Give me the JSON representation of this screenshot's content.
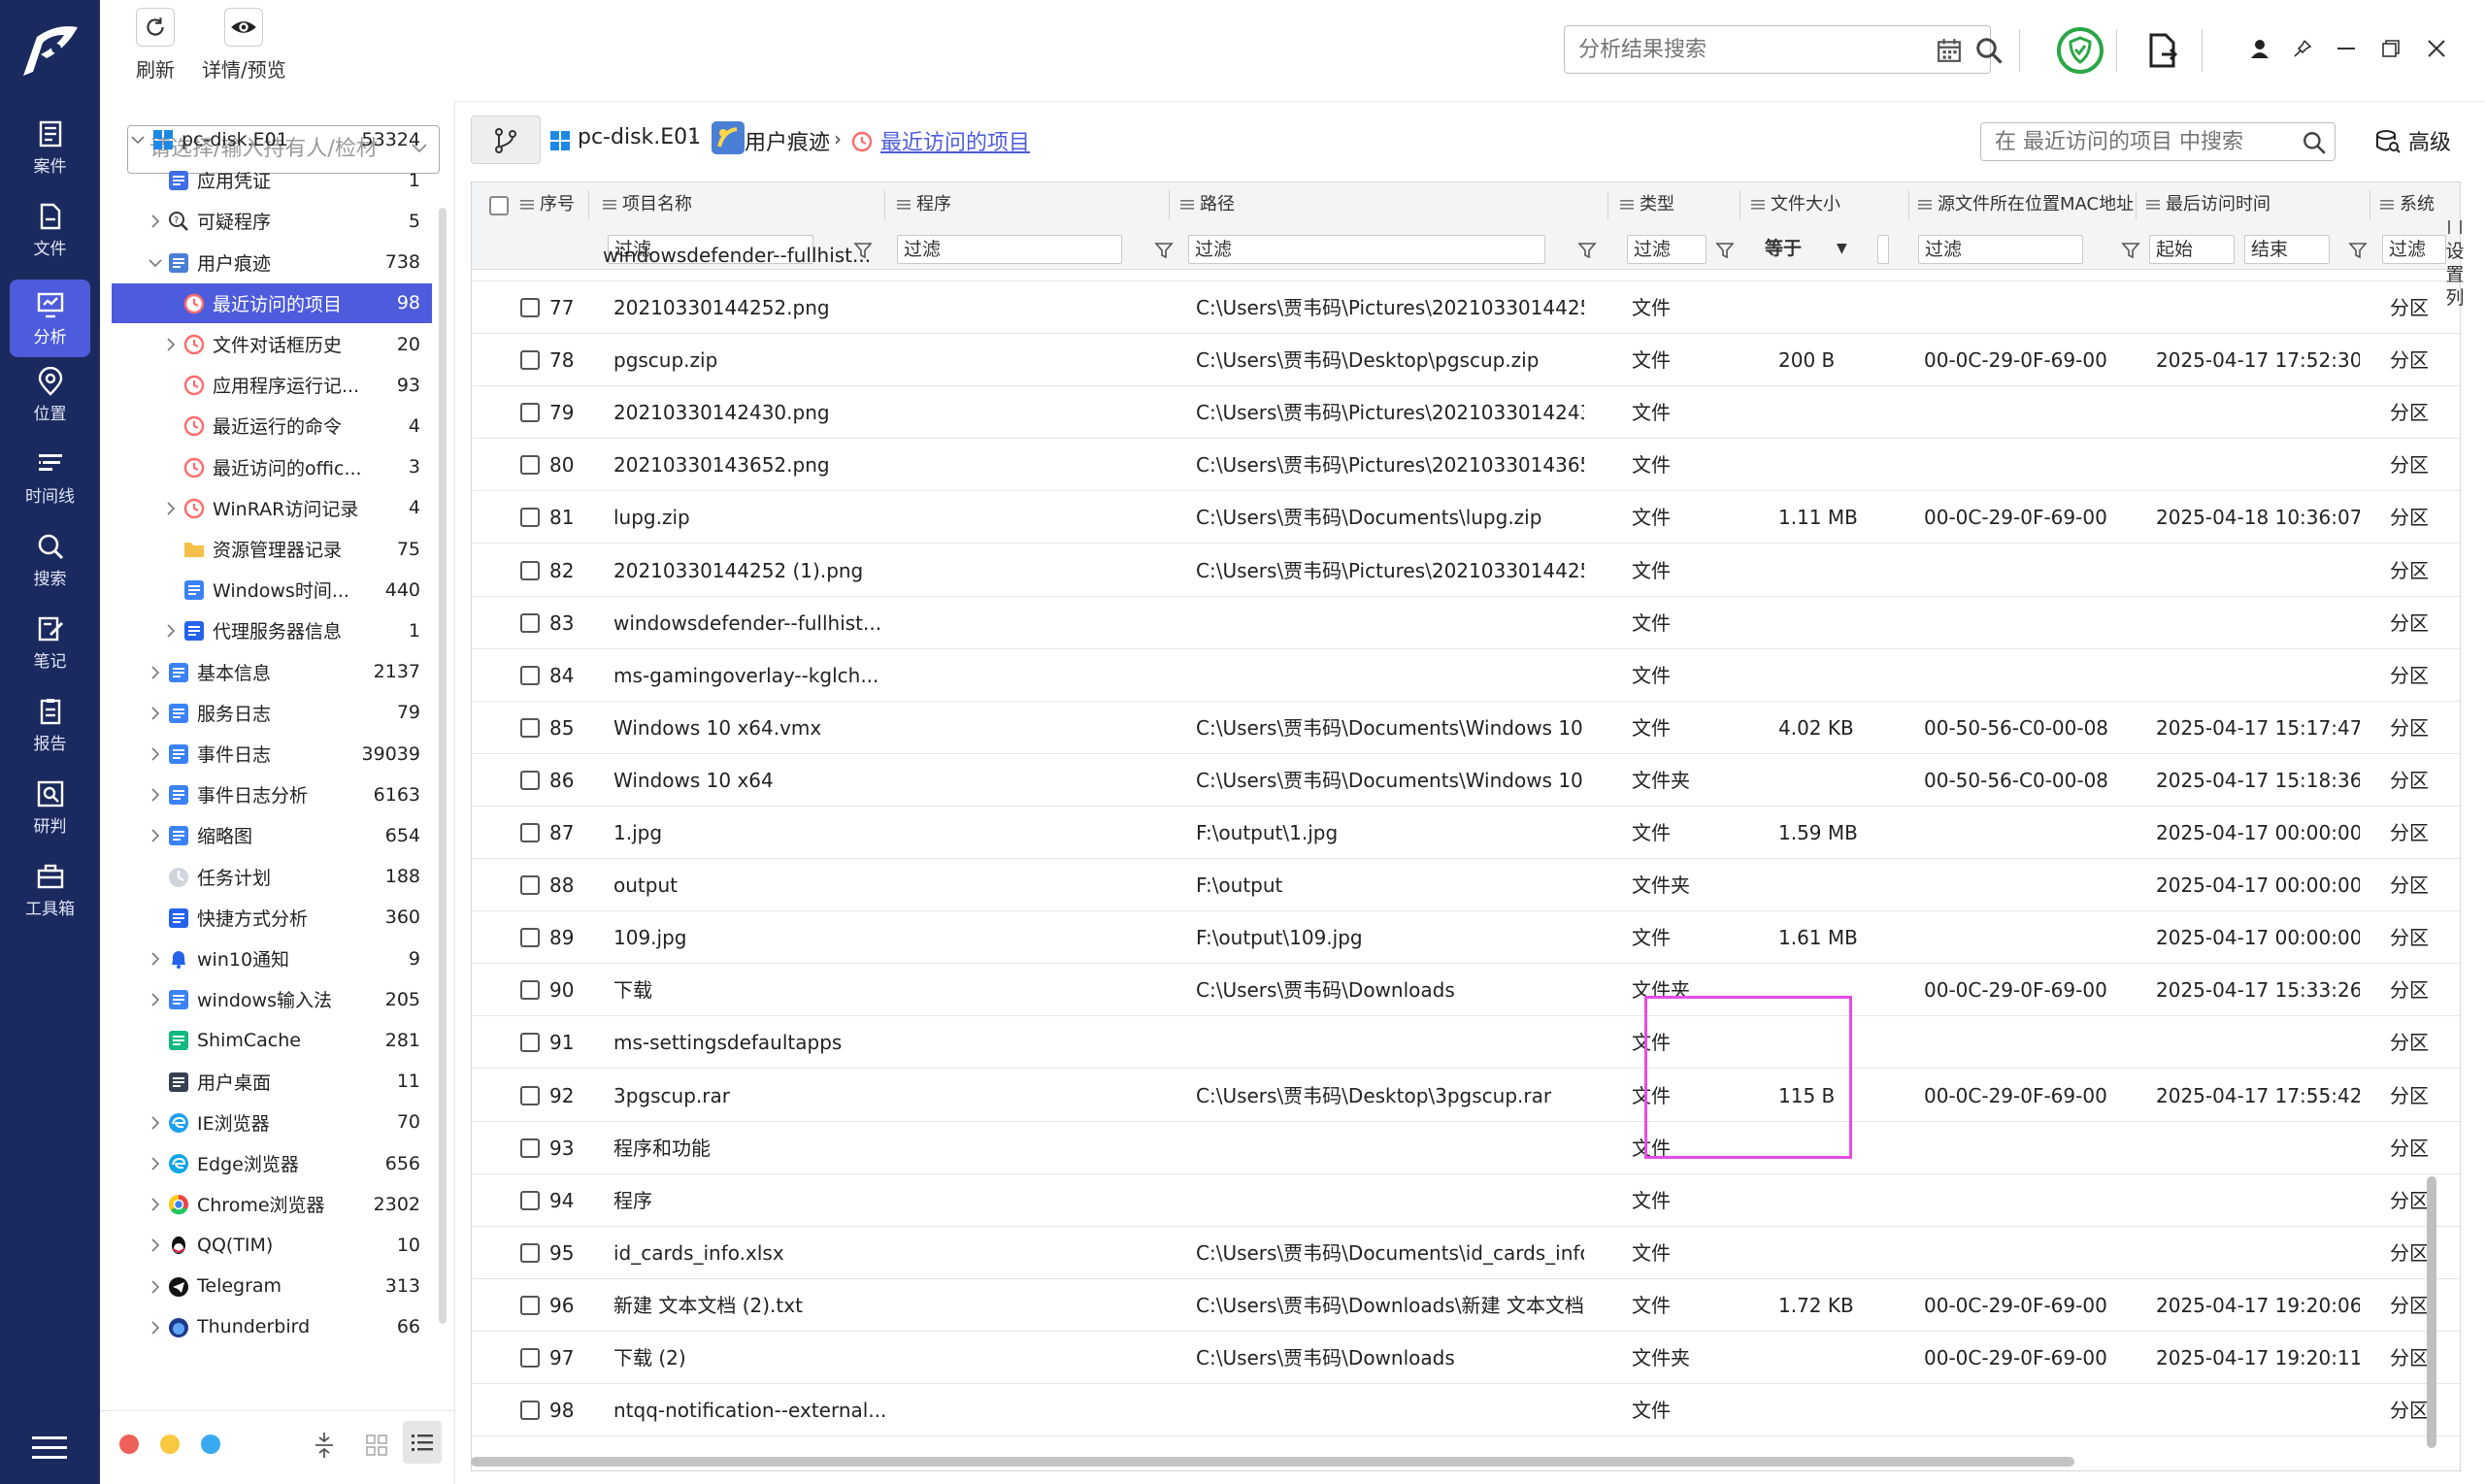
{
  "toolbar": {
    "refresh_label": "刷新",
    "detail_label": "详情/预览",
    "search_placeholder": "分析结果搜索"
  },
  "nav": [
    {
      "label": "案件",
      "icon": "case-icon"
    },
    {
      "label": "文件",
      "icon": "file-icon"
    },
    {
      "label": "分析",
      "icon": "analysis-icon",
      "active": true
    },
    {
      "label": "位置",
      "icon": "location-icon"
    },
    {
      "label": "时间线",
      "icon": "timeline-icon"
    },
    {
      "label": "搜索",
      "icon": "search-icon"
    },
    {
      "label": "笔记",
      "icon": "note-icon"
    },
    {
      "label": "报告",
      "icon": "report-icon"
    },
    {
      "label": "研判",
      "icon": "judge-icon"
    },
    {
      "label": "工具箱",
      "icon": "toolbox-icon"
    }
  ],
  "sidebar": {
    "owner_placeholder": "请选择/输入持有人/检材",
    "tree": [
      {
        "label": "pc-disk.E01",
        "count": "53324",
        "level": 0,
        "expanded": true,
        "icon": "windows-icon",
        "color": "#1e88e5"
      },
      {
        "label": "应用凭证",
        "count": "1",
        "level": 1,
        "icon": "credential-icon",
        "color": "#3f6ee8"
      },
      {
        "label": "可疑程序",
        "count": "5",
        "level": 1,
        "chev": true,
        "icon": "suspicious-icon",
        "color": "#333333"
      },
      {
        "label": "用户痕迹",
        "count": "738",
        "level": 1,
        "expanded": true,
        "icon": "user-trace-icon",
        "color": "#4a7fd6"
      },
      {
        "label": "最近访问的项目",
        "count": "98",
        "level": 2,
        "selected": true,
        "icon": "clock-icon",
        "color": "#ff6b6b"
      },
      {
        "label": "文件对话框历史",
        "count": "20",
        "level": 2,
        "chev": true,
        "icon": "clock-icon",
        "color": "#ff6b6b"
      },
      {
        "label": "应用程序运行记...",
        "count": "93",
        "level": 2,
        "icon": "clock-icon",
        "color": "#ff6b6b"
      },
      {
        "label": "最近运行的命令",
        "count": "4",
        "level": 2,
        "icon": "clock-icon",
        "color": "#ff6b6b"
      },
      {
        "label": "最近访问的offic...",
        "count": "3",
        "level": 2,
        "icon": "clock-icon",
        "color": "#ff6b6b"
      },
      {
        "label": "WinRAR访问记录",
        "count": "4",
        "level": 2,
        "chev": true,
        "icon": "clock-icon",
        "color": "#ff6b6b"
      },
      {
        "label": "资源管理器记录",
        "count": "75",
        "level": 2,
        "icon": "folder-icon",
        "color": "#f5c04a"
      },
      {
        "label": "Windows时间...",
        "count": "440",
        "level": 2,
        "icon": "timeline-list-icon",
        "color": "#3b82f6"
      },
      {
        "label": "代理服务器信息",
        "count": "1",
        "level": 2,
        "chev": true,
        "icon": "proxy-icon",
        "color": "#2563eb"
      },
      {
        "label": "基本信息",
        "count": "2137",
        "level": 1,
        "chev": true,
        "icon": "info-icon",
        "color": "#3b82f6"
      },
      {
        "label": "服务日志",
        "count": "79",
        "level": 1,
        "chev": true,
        "icon": "service-icon",
        "color": "#3b82f6"
      },
      {
        "label": "事件日志",
        "count": "39039",
        "level": 1,
        "chev": true,
        "icon": "event-log-icon",
        "color": "#3b82f6"
      },
      {
        "label": "事件日志分析",
        "count": "6163",
        "level": 1,
        "chev": true,
        "icon": "event-analysis-icon",
        "color": "#3b82f6"
      },
      {
        "label": "缩略图",
        "count": "654",
        "level": 1,
        "chev": true,
        "icon": "thumbnail-icon",
        "color": "#3b82f6"
      },
      {
        "label": "任务计划",
        "count": "188",
        "level": 1,
        "icon": "task-icon",
        "color": "#9ca3af"
      },
      {
        "label": "快捷方式分析",
        "count": "360",
        "level": 1,
        "icon": "shortcut-icon",
        "color": "#2563eb"
      },
      {
        "label": "win10通知",
        "count": "9",
        "level": 1,
        "chev": true,
        "icon": "bell-icon",
        "color": "#2563eb"
      },
      {
        "label": "windows输入法",
        "count": "205",
        "level": 1,
        "chev": true,
        "icon": "keyboard-icon",
        "color": "#3b82f6"
      },
      {
        "label": "ShimCache",
        "count": "281",
        "level": 1,
        "icon": "shimcache-icon",
        "color": "#10b981"
      },
      {
        "label": "用户桌面",
        "count": "11",
        "level": 1,
        "icon": "desktop-icon",
        "color": "#374151"
      },
      {
        "label": "IE浏览器",
        "count": "70",
        "level": 1,
        "chev": true,
        "icon": "ie-icon",
        "color": "#1da1f2"
      },
      {
        "label": "Edge浏览器",
        "count": "656",
        "level": 1,
        "chev": true,
        "icon": "edge-icon",
        "color": "#0ea5e9"
      },
      {
        "label": "Chrome浏览器",
        "count": "2302",
        "level": 1,
        "chev": true,
        "icon": "chrome-icon",
        "color": "#ef4444"
      },
      {
        "label": "QQ(TIM)",
        "count": "10",
        "level": 1,
        "chev": true,
        "icon": "qq-icon",
        "color": "#111111"
      },
      {
        "label": "Telegram",
        "count": "313",
        "level": 1,
        "chev": true,
        "icon": "telegram-icon",
        "color": "#111111"
      },
      {
        "label": "Thunderbird",
        "count": "66",
        "level": 1,
        "chev": true,
        "icon": "thunderbird-icon",
        "color": "#1e3a8a"
      }
    ]
  },
  "breadcrumb": {
    "disk": "pc-disk.E01",
    "group": "用户痕迹",
    "current": "最近访问的项目",
    "filter_placeholder": "在 最近访问的项目 中搜索",
    "advanced_label": "高级"
  },
  "grid": {
    "columns": [
      "序号",
      "项目名称",
      "程序",
      "路径",
      "类型",
      "文件大小",
      "源文件所在位置MAC地址",
      "最后访问时间",
      "系统"
    ],
    "filters": {
      "placeholder": "过滤",
      "size_op": "等于",
      "start": "起始",
      "end": "结束"
    },
    "column_setting": "设置列",
    "partial_row": {
      "name": "windowsdefender--fullhist..."
    },
    "rows": [
      {
        "id": "77",
        "name": "20210330144252.png",
        "path": "C:\\Users\\贾韦码\\Pictures\\20210330144252...",
        "type": "文件",
        "size": "",
        "mac": "",
        "time": "",
        "sys": "分区"
      },
      {
        "id": "78",
        "name": "pgscup.zip",
        "path": "C:\\Users\\贾韦码\\Desktop\\pgscup.zip",
        "type": "文件",
        "size": "200 B",
        "mac": "00-0C-29-0F-69-00",
        "time": "2025-04-17 17:52:30",
        "sys": "分区"
      },
      {
        "id": "79",
        "name": "20210330142430.png",
        "path": "C:\\Users\\贾韦码\\Pictures\\20210330142430...",
        "type": "文件",
        "size": "",
        "mac": "",
        "time": "",
        "sys": "分区"
      },
      {
        "id": "80",
        "name": "20210330143652.png",
        "path": "C:\\Users\\贾韦码\\Pictures\\20210330143652...",
        "type": "文件",
        "size": "",
        "mac": "",
        "time": "",
        "sys": "分区"
      },
      {
        "id": "81",
        "name": "lupg.zip",
        "path": "C:\\Users\\贾韦码\\Documents\\lupg.zip",
        "type": "文件",
        "size": "1.11 MB",
        "mac": "00-0C-29-0F-69-00",
        "time": "2025-04-18 10:36:07",
        "sys": "分区"
      },
      {
        "id": "82",
        "name": "20210330144252 (1).png",
        "path": "C:\\Users\\贾韦码\\Pictures\\20210330144252...",
        "type": "文件",
        "size": "",
        "mac": "",
        "time": "",
        "sys": "分区"
      },
      {
        "id": "83",
        "name": "windowsdefender--fullhist...",
        "path": "",
        "type": "文件",
        "size": "",
        "mac": "",
        "time": "",
        "sys": "分区"
      },
      {
        "id": "84",
        "name": "ms-gamingoverlay--kglch...",
        "path": "",
        "type": "文件",
        "size": "",
        "mac": "",
        "time": "",
        "sys": "分区"
      },
      {
        "id": "85",
        "name": "Windows 10 x64.vmx",
        "path": "C:\\Users\\贾韦码\\Documents\\Windows 10 x...",
        "type": "文件",
        "size": "4.02 KB",
        "mac": "00-50-56-C0-00-08",
        "time": "2025-04-17 15:17:47",
        "sys": "分区"
      },
      {
        "id": "86",
        "name": "Windows 10 x64",
        "path": "C:\\Users\\贾韦码\\Documents\\Windows 10 x...",
        "type": "文件夹",
        "size": "",
        "mac": "00-50-56-C0-00-08",
        "time": "2025-04-17 15:18:36",
        "sys": "分区"
      },
      {
        "id": "87",
        "name": "1.jpg",
        "path": "F:\\output\\1.jpg",
        "type": "文件",
        "size": "1.59 MB",
        "mac": "",
        "time": "2025-04-17 00:00:00",
        "sys": "分区"
      },
      {
        "id": "88",
        "name": "output",
        "path": "F:\\output",
        "type": "文件夹",
        "size": "",
        "mac": "",
        "time": "2025-04-17 00:00:00",
        "sys": "分区"
      },
      {
        "id": "89",
        "name": "109.jpg",
        "path": "F:\\output\\109.jpg",
        "type": "文件",
        "size": "1.61 MB",
        "mac": "",
        "time": "2025-04-17 00:00:00",
        "sys": "分区"
      },
      {
        "id": "90",
        "name": "下载",
        "path": "C:\\Users\\贾韦码\\Downloads",
        "type": "文件夹",
        "size": "",
        "mac": "00-0C-29-0F-69-00",
        "time": "2025-04-17 15:33:26",
        "sys": "分区"
      },
      {
        "id": "91",
        "name": "ms-settingsdefaultapps",
        "path": "",
        "type": "文件",
        "size": "",
        "mac": "",
        "time": "",
        "sys": "分区"
      },
      {
        "id": "92",
        "name": "3pgscup.rar",
        "path": "C:\\Users\\贾韦码\\Desktop\\3pgscup.rar",
        "type": "文件",
        "size": "115 B",
        "mac": "00-0C-29-0F-69-00",
        "time": "2025-04-17 17:55:42",
        "sys": "分区"
      },
      {
        "id": "93",
        "name": "程序和功能",
        "path": "",
        "type": "文件",
        "size": "",
        "mac": "",
        "time": "",
        "sys": "分区"
      },
      {
        "id": "94",
        "name": "程序",
        "path": "",
        "type": "文件",
        "size": "",
        "mac": "",
        "time": "",
        "sys": "分区"
      },
      {
        "id": "95",
        "name": "id_cards_info.xlsx",
        "path": "C:\\Users\\贾韦码\\Documents\\id_cards_info....",
        "type": "文件",
        "size": "",
        "mac": "",
        "time": "",
        "sys": "分区"
      },
      {
        "id": "96",
        "name": "新建 文本文档 (2).txt",
        "path": "C:\\Users\\贾韦码\\Downloads\\新建 文本文档...",
        "type": "文件",
        "size": "1.72 KB",
        "mac": "00-0C-29-0F-69-00",
        "time": "2025-04-17 19:20:06",
        "sys": "分区"
      },
      {
        "id": "97",
        "name": "下载 (2)",
        "path": "C:\\Users\\贾韦码\\Downloads",
        "type": "文件夹",
        "size": "",
        "mac": "00-0C-29-0F-69-00",
        "time": "2025-04-17 19:20:11",
        "sys": "分区"
      },
      {
        "id": "98",
        "name": "ntqq-notification--external...",
        "path": "",
        "type": "文件",
        "size": "",
        "mac": "",
        "time": "",
        "sys": "分区"
      }
    ]
  },
  "colors": {
    "nav_bg": "#1b2a5e",
    "accent": "#4d5cdc",
    "highlight": "#e64be6",
    "shield": "#2aa745",
    "link": "#4d5cdc"
  }
}
